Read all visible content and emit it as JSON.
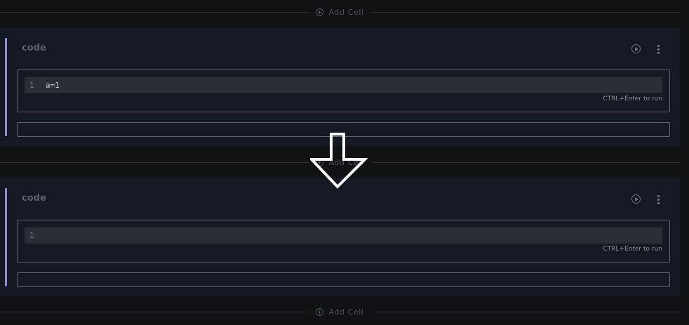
{
  "add_cell_label": "Add Cell",
  "cells": [
    {
      "type_label": "code",
      "line_number": "1",
      "code": "a=1",
      "hint": "CTRL+Enter to run"
    },
    {
      "type_label": "code",
      "line_number": "1",
      "code": "",
      "hint": "CTRL+Enter to run"
    }
  ],
  "colors": {
    "accent": "#9b87db",
    "background": "#101214",
    "cell_background": "#141923",
    "arrow": "#ffffff"
  },
  "icons": {
    "add_cell": "plus-circle-icon",
    "run": "play-circle-icon",
    "menu": "more-vertical-icon",
    "overlay": "down-arrow-icon"
  }
}
